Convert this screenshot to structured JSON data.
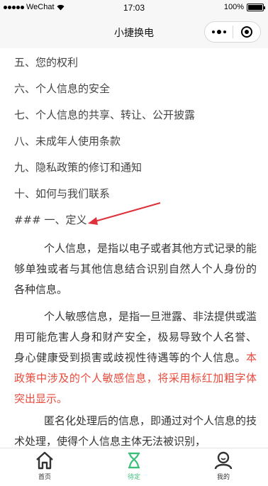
{
  "status_bar": {
    "carrier": "WeChat",
    "time": "17:03",
    "battery_text": "100%",
    "battery_level": 1.0
  },
  "nav": {
    "title": "小捷换电"
  },
  "toc": [
    "五、您的权利",
    "六、个人信息的安全",
    "七、个人信息的共享、转让、公开披露",
    "八、未成年人使用条款",
    "九、隐私政策的修订和通知",
    "十、如何与我们联系"
  ],
  "section_heading": "### 一、定义",
  "paragraphs": {
    "p1": "个人信息，是指以电子或者其他方式记录的能够单独或者与其他信息结合识别自然人个人身份的各种信息。",
    "p2_normal": "个人敏感信息，是指一旦泄露、非法提供或滥用可能危害人身和财产安全，极易导致个人名誉、身心健康受到损害或歧视性待遇等的个人信息。",
    "p2_red": "本政策中涉及的个人敏感信息，将采用标红加粗字体突出显示。",
    "p3": "匿名化处理后的信息，即通过对个人信息的技术处理，使得个人信息主体无法被识别，"
  },
  "tabs": [
    {
      "label": "首页",
      "icon": "home-icon"
    },
    {
      "label": "待定",
      "icon": "hourglass-icon"
    },
    {
      "label": "我的",
      "icon": "user-icon"
    }
  ],
  "colors": {
    "accent_green": "#3dbf7c",
    "highlight_red": "#e84a3c",
    "annotation_arrow": "#e0303a"
  }
}
